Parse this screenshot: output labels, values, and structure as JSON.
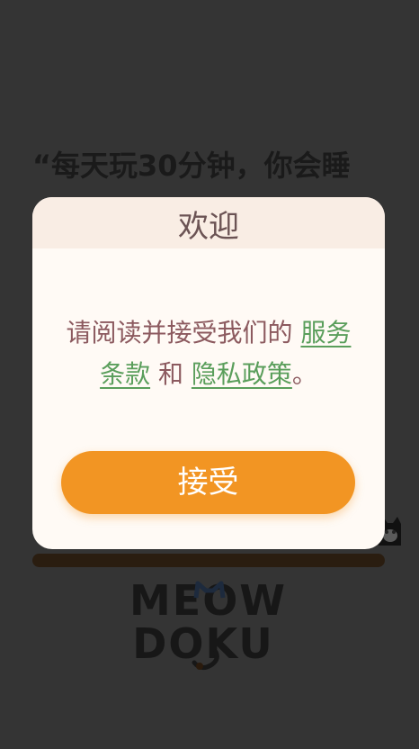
{
  "background": {
    "quote_text": "“每天玩30分钟，你会睡",
    "logo_top": "MEOW",
    "logo_bottom": "DOKU"
  },
  "modal": {
    "title": "欢迎",
    "body_prefix": "请阅读并接受我们的 ",
    "terms_link": "服务条款",
    "body_and": " 和 ",
    "privacy_link": "隐私政策",
    "body_suffix": "。",
    "accept_label": "接受"
  },
  "colors": {
    "overlay": "#343434",
    "modal_bg": "#fffaf5",
    "header_bg": "#f9ede4",
    "title_text": "#6b5354",
    "body_text": "#8c5a5f",
    "link": "#5a9e5b",
    "accent": "#f29523"
  },
  "icons": [
    "cat-peek-icon",
    "cat-ears-icon",
    "cat-tail-icon"
  ]
}
